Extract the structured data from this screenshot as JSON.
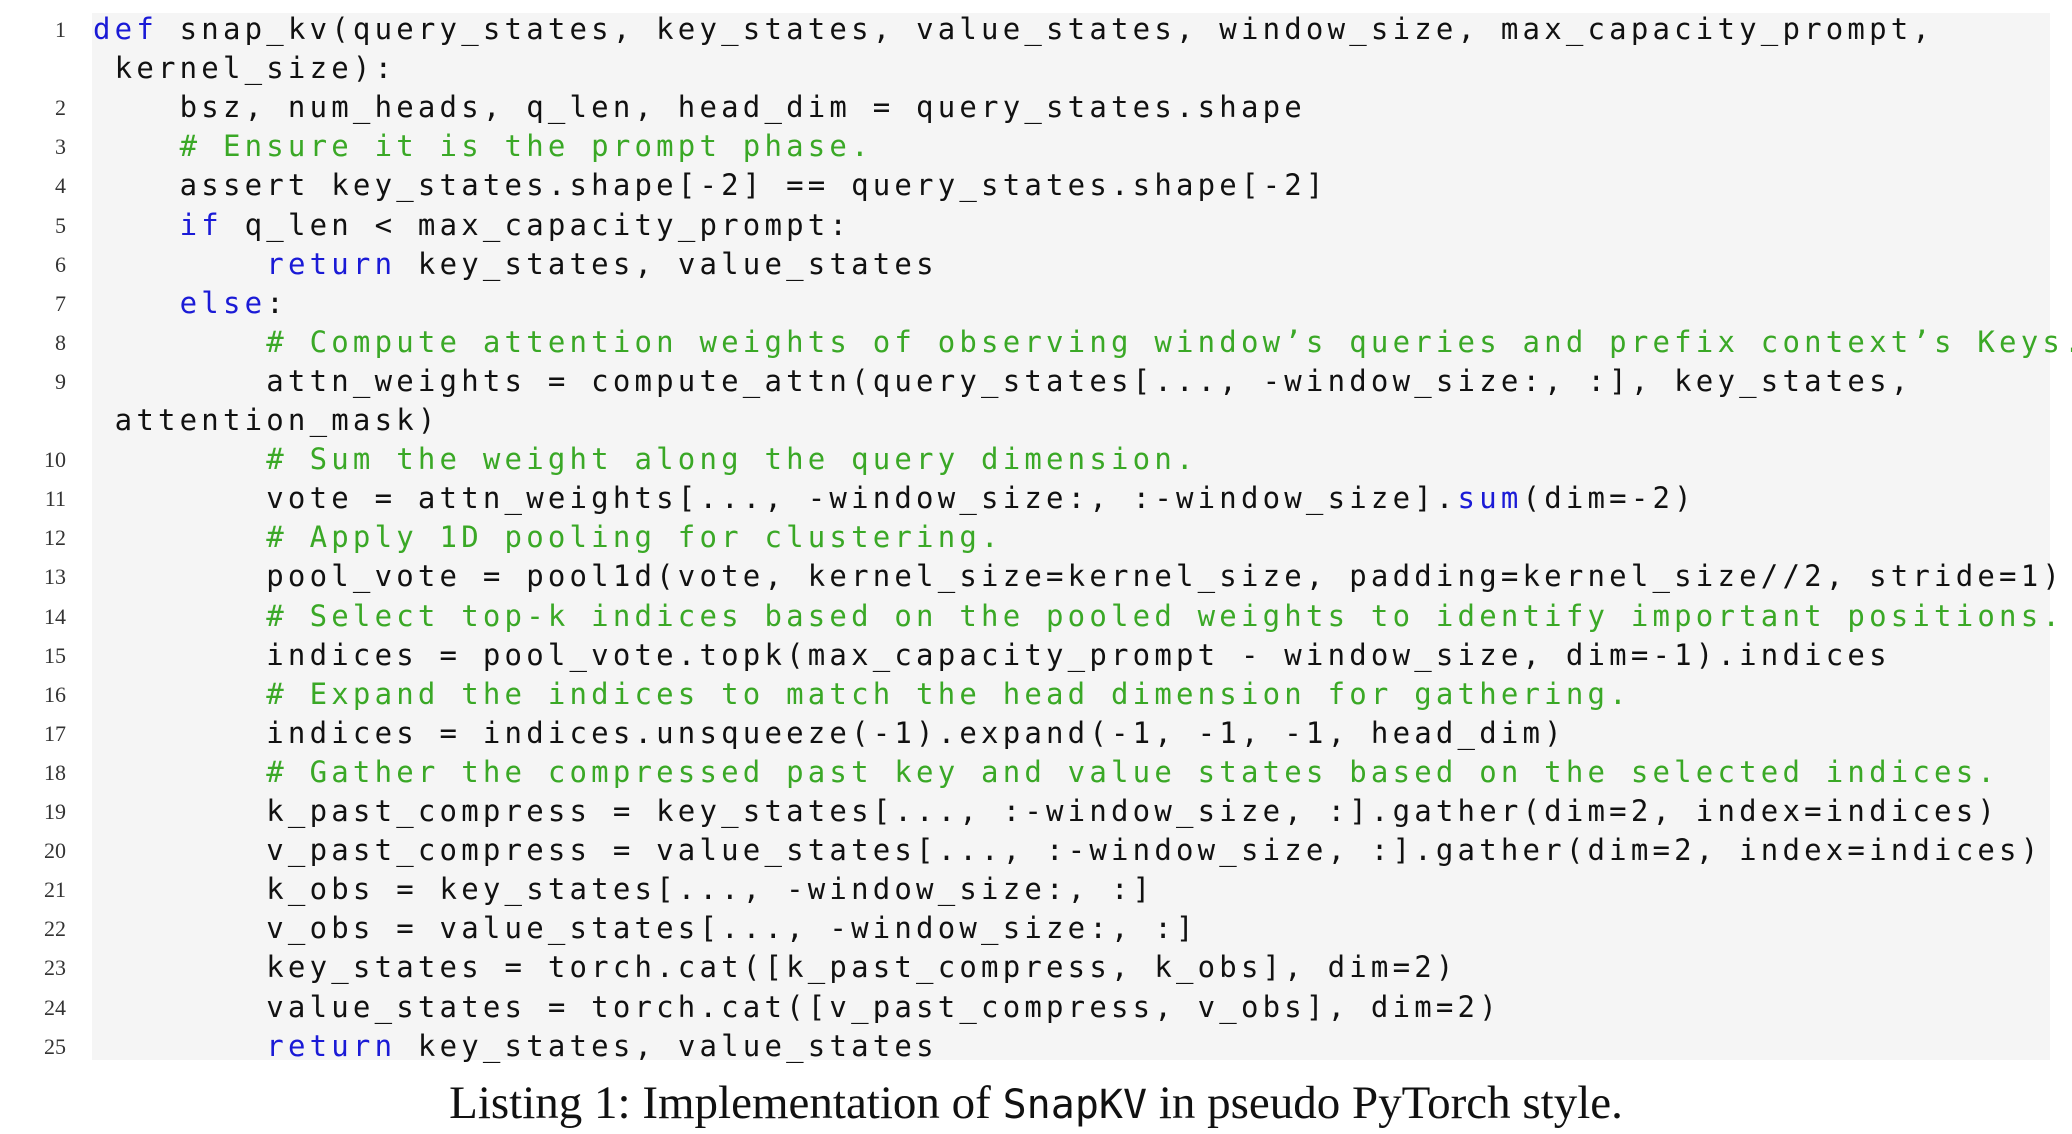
{
  "listing": {
    "line_numbers": [
      "1",
      "2",
      "3",
      "4",
      "5",
      "6",
      "7",
      "8",
      "9",
      "10",
      "11",
      "12",
      "13",
      "14",
      "15",
      "16",
      "17",
      "18",
      "19",
      "20",
      "21",
      "22",
      "23",
      "24",
      "25"
    ],
    "lines": [
      {
        "num": "1",
        "segs": [
          {
            "t": "def",
            "c": "kw"
          },
          {
            "t": " snap_kv(query_states, key_states, value_states, window_size, max_capacity_prompt,",
            "c": ""
          }
        ]
      },
      {
        "num": "",
        "segs": [
          {
            "t": " kernel_size):",
            "c": ""
          }
        ]
      },
      {
        "num": "2",
        "segs": [
          {
            "t": "    bsz, num_heads, q_len, head_dim = query_states.shape",
            "c": ""
          }
        ]
      },
      {
        "num": "3",
        "segs": [
          {
            "t": "    # Ensure it is the prompt phase.",
            "c": "cm"
          }
        ]
      },
      {
        "num": "4",
        "segs": [
          {
            "t": "    assert key_states.shape[-2] == query_states.shape[-2]",
            "c": ""
          }
        ]
      },
      {
        "num": "5",
        "segs": [
          {
            "t": "    ",
            "c": ""
          },
          {
            "t": "if",
            "c": "kw"
          },
          {
            "t": " q_len < max_capacity_prompt:",
            "c": ""
          }
        ]
      },
      {
        "num": "6",
        "segs": [
          {
            "t": "        ",
            "c": ""
          },
          {
            "t": "return",
            "c": "kw"
          },
          {
            "t": " key_states, value_states",
            "c": ""
          }
        ]
      },
      {
        "num": "7",
        "segs": [
          {
            "t": "    ",
            "c": ""
          },
          {
            "t": "else",
            "c": "kw"
          },
          {
            "t": ":",
            "c": ""
          }
        ]
      },
      {
        "num": "8",
        "segs": [
          {
            "t": "        # Compute attention weights of observing window’s queries and prefix context’s Keys.",
            "c": "cm"
          }
        ]
      },
      {
        "num": "9",
        "segs": [
          {
            "t": "        attn_weights = compute_attn(query_states[..., -window_size:, :], key_states,",
            "c": ""
          }
        ]
      },
      {
        "num": "",
        "segs": [
          {
            "t": " attention_mask)",
            "c": ""
          }
        ]
      },
      {
        "num": "10",
        "segs": [
          {
            "t": "        # Sum the weight along the query dimension.",
            "c": "cm"
          }
        ]
      },
      {
        "num": "11",
        "segs": [
          {
            "t": "        vote = attn_weights[..., -window_size:, :-window_size].",
            "c": ""
          },
          {
            "t": "sum",
            "c": "kw"
          },
          {
            "t": "(dim=-2)",
            "c": ""
          }
        ]
      },
      {
        "num": "12",
        "segs": [
          {
            "t": "        # Apply 1D pooling for clustering.",
            "c": "cm"
          }
        ]
      },
      {
        "num": "13",
        "segs": [
          {
            "t": "        pool_vote = pool1d(vote, kernel_size=kernel_size, padding=kernel_size//2, stride=1)",
            "c": ""
          }
        ]
      },
      {
        "num": "14",
        "segs": [
          {
            "t": "        # Select top-k indices based on the pooled weights to identify important positions.",
            "c": "cm"
          }
        ]
      },
      {
        "num": "15",
        "segs": [
          {
            "t": "        indices = pool_vote.topk(max_capacity_prompt - window_size, dim=-1).indices",
            "c": ""
          }
        ]
      },
      {
        "num": "16",
        "segs": [
          {
            "t": "        # Expand the indices to match the head dimension for gathering.",
            "c": "cm"
          }
        ]
      },
      {
        "num": "17",
        "segs": [
          {
            "t": "        indices = indices.unsqueeze(-1).expand(-1, -1, -1, head_dim)",
            "c": ""
          }
        ]
      },
      {
        "num": "18",
        "segs": [
          {
            "t": "        # Gather the compressed past key and value states based on the selected indices.",
            "c": "cm"
          }
        ]
      },
      {
        "num": "19",
        "segs": [
          {
            "t": "        k_past_compress = key_states[..., :-window_size, :].gather(dim=2, index=indices)",
            "c": ""
          }
        ]
      },
      {
        "num": "20",
        "segs": [
          {
            "t": "        v_past_compress = value_states[..., :-window_size, :].gather(dim=2, index=indices)",
            "c": ""
          }
        ]
      },
      {
        "num": "21",
        "segs": [
          {
            "t": "        k_obs = key_states[..., -window_size:, :]",
            "c": ""
          }
        ]
      },
      {
        "num": "22",
        "segs": [
          {
            "t": "        v_obs = value_states[..., -window_size:, :]",
            "c": ""
          }
        ]
      },
      {
        "num": "23",
        "segs": [
          {
            "t": "        key_states = torch.cat([k_past_compress, k_obs], dim=2)",
            "c": ""
          }
        ]
      },
      {
        "num": "24",
        "segs": [
          {
            "t": "        value_states = torch.cat([v_past_compress, v_obs], dim=2)",
            "c": ""
          }
        ]
      },
      {
        "num": "25",
        "segs": [
          {
            "t": "        ",
            "c": ""
          },
          {
            "t": "return",
            "c": "kw"
          },
          {
            "t": " key_states, value_states",
            "c": ""
          }
        ]
      }
    ]
  },
  "caption": {
    "prefix": "Listing 1: Implementation of ",
    "code": "SnapKV",
    "suffix": " in pseudo PyTorch style."
  },
  "colors": {
    "keyword": "#1a1ad6",
    "comment": "#3aa826",
    "background": "#f5f5f5"
  }
}
